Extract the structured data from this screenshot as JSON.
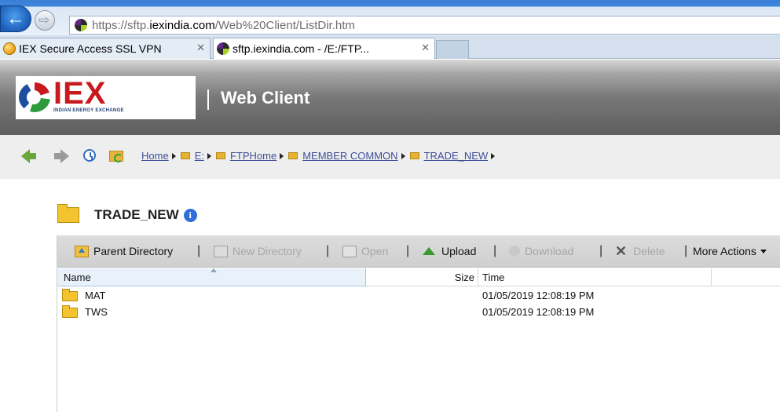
{
  "browser": {
    "url_prefix": "https://sftp.",
    "url_domain": "iexindia.com",
    "url_path": "/Web%20Client/ListDir.htm",
    "tabs": [
      {
        "title": "IEX Secure Access SSL VPN",
        "icon": "globe-icon",
        "active": false
      },
      {
        "title": "sftp.iexindia.com - /E:/FTP...",
        "icon": "iex-site-icon",
        "active": true
      }
    ],
    "close_glyph": "✕",
    "back_glyph": "←",
    "forward_glyph": "⇨"
  },
  "header": {
    "logo_text": "IEX",
    "logo_sub": "INDIAN ENERGY EXCHANGE",
    "title": "Web Client"
  },
  "breadcrumb": {
    "items": [
      "Home",
      "E:",
      "FTPHome",
      "MEMBER COMMON",
      "TRADE_NEW"
    ]
  },
  "folder": {
    "name": "TRADE_NEW",
    "info_glyph": "i"
  },
  "toolbar": {
    "parent_directory": "Parent Directory",
    "new_directory": "New Directory",
    "open": "Open",
    "upload": "Upload",
    "download": "Download",
    "delete": "Delete",
    "more_actions": "More Actions",
    "separator": "|",
    "delete_glyph": "✕"
  },
  "columns": {
    "name": "Name",
    "size": "Size",
    "time": "Time"
  },
  "files": [
    {
      "name": "MAT",
      "size": "",
      "time": "01/05/2019 12:08:19 PM"
    },
    {
      "name": "TWS",
      "size": "",
      "time": "01/05/2019 12:08:19 PM"
    }
  ],
  "colors": {
    "accent_blue": "#2f6fd6",
    "logo_red": "#c8191f",
    "folder_yellow": "#f4c430",
    "link": "#3e4f9a"
  }
}
